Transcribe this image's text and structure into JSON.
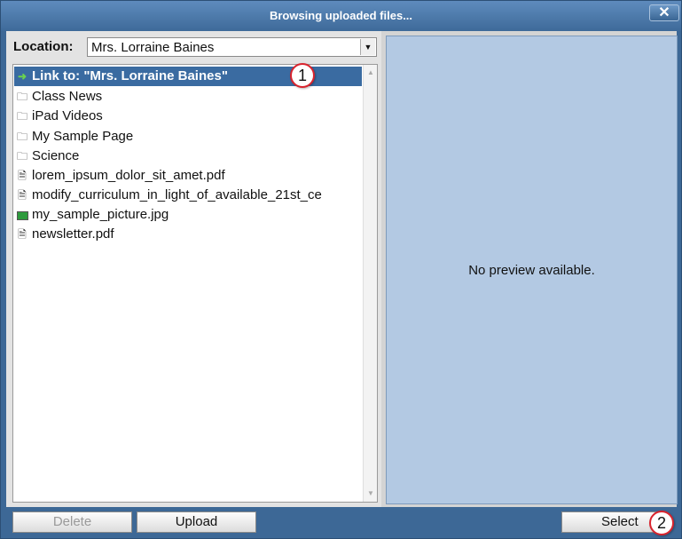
{
  "window": {
    "title": "Browsing uploaded files...",
    "close_label": "✕"
  },
  "location": {
    "label": "Location:",
    "value": "Mrs. Lorraine Baines"
  },
  "file_list": {
    "items": [
      {
        "label": "Link to: \"Mrs. Lorraine Baines\"",
        "icon": "arrow-right-icon",
        "selected": true
      },
      {
        "label": "Class News",
        "icon": "folder-icon"
      },
      {
        "label": "iPad Videos",
        "icon": "folder-icon"
      },
      {
        "label": "My Sample Page",
        "icon": "folder-icon"
      },
      {
        "label": "Science",
        "icon": "folder-icon"
      },
      {
        "label": "lorem_ipsum_dolor_sit_amet.pdf",
        "icon": "document-icon"
      },
      {
        "label": "modify_curriculum_in_light_of_available_21st_ce",
        "icon": "document-icon"
      },
      {
        "label": "my_sample_picture.jpg",
        "icon": "image-icon"
      },
      {
        "label": "newsletter.pdf",
        "icon": "document-icon"
      }
    ]
  },
  "preview": {
    "text": "No preview available."
  },
  "footer": {
    "delete_label": "Delete",
    "upload_label": "Upload",
    "select_label": "Select"
  },
  "annotations": {
    "badge_1": "1",
    "badge_2": "2"
  },
  "colors": {
    "window_blue": "#3d6896",
    "selection_blue": "#3a6ba1",
    "preview_bg": "#b3c9e3",
    "badge_red": "#d9232d"
  }
}
